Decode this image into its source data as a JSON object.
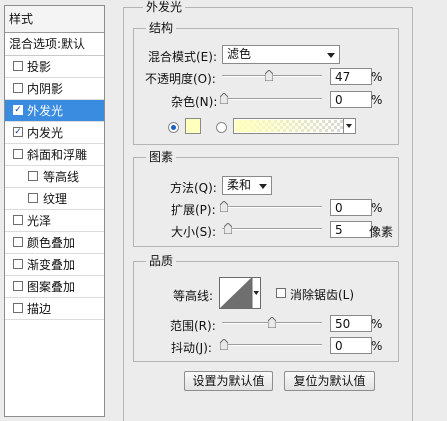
{
  "sidebar": {
    "header": "样式",
    "default_item": "混合选项:默认",
    "items": [
      {
        "label": "投影",
        "checked": false
      },
      {
        "label": "内阴影",
        "checked": false
      },
      {
        "label": "外发光",
        "checked": true,
        "selected": true
      },
      {
        "label": "内发光",
        "checked": true
      },
      {
        "label": "斜面和浮雕",
        "checked": false
      },
      {
        "label": "等高线",
        "checked": false
      },
      {
        "label": "纹理",
        "checked": false
      },
      {
        "label": "光泽",
        "checked": false
      },
      {
        "label": "颜色叠加",
        "checked": false
      },
      {
        "label": "渐变叠加",
        "checked": false
      },
      {
        "label": "图案叠加",
        "checked": false
      },
      {
        "label": "描边",
        "checked": false
      }
    ],
    "check_mark": "✓"
  },
  "panel": {
    "title": "外发光",
    "structure": {
      "title": "结构",
      "blend_mode_label": "混合模式(E):",
      "blend_mode_value": "滤色",
      "opacity_label": "不透明度(O):",
      "opacity_value": "47",
      "opacity_unit": "%",
      "noise_label": "杂色(N):",
      "noise_value": "0",
      "noise_unit": "%",
      "solid_color": "#ffffbe",
      "gradient_from": "#ffffbe"
    },
    "elements": {
      "title": "图素",
      "technique_label": "方法(Q):",
      "technique_value": "柔和",
      "spread_label": "扩展(P):",
      "spread_value": "0",
      "spread_unit": "%",
      "size_label": "大小(S):",
      "size_value": "5",
      "size_unit": "像素"
    },
    "quality": {
      "title": "品质",
      "contour_label": "等高线:",
      "antialias_label": "消除锯齿(L)",
      "antialias_checked": false,
      "range_label": "范围(R):",
      "range_value": "50",
      "range_unit": "%",
      "jitter_label": "抖动(J):",
      "jitter_value": "0",
      "jitter_unit": "%"
    },
    "buttons": {
      "make_default": "设置为默认值",
      "reset_default": "复位为默认值"
    }
  }
}
